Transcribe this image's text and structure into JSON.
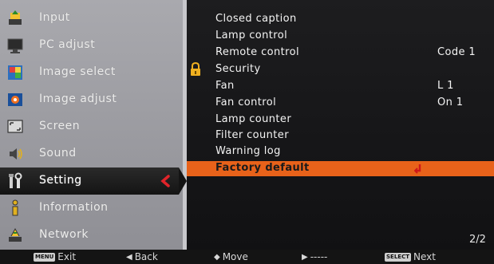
{
  "left_menu": {
    "items": [
      {
        "label": "Input",
        "icon": "input-icon"
      },
      {
        "label": "PC adjust",
        "icon": "monitor-icon"
      },
      {
        "label": "Image select",
        "icon": "image-select-icon"
      },
      {
        "label": "Image adjust",
        "icon": "image-adjust-icon"
      },
      {
        "label": "Screen",
        "icon": "screen-icon"
      },
      {
        "label": "Sound",
        "icon": "speaker-icon"
      },
      {
        "label": "Setting",
        "icon": "setting-icon",
        "active": true
      },
      {
        "label": "Information",
        "icon": "information-icon"
      },
      {
        "label": "Network",
        "icon": "network-icon"
      }
    ]
  },
  "settings_list": {
    "rows": [
      {
        "label": "Closed caption",
        "value": ""
      },
      {
        "label": "Lamp control",
        "value": ""
      },
      {
        "label": "Remote control",
        "value": "Code 1"
      },
      {
        "label": "Security",
        "value": "",
        "icon": "lock-icon"
      },
      {
        "label": "Fan",
        "value": "L 1"
      },
      {
        "label": "Fan control",
        "value": "On 1"
      },
      {
        "label": "Lamp counter",
        "value": ""
      },
      {
        "label": "Filter counter",
        "value": ""
      },
      {
        "label": "Warning log",
        "value": ""
      },
      {
        "label": "Factory default",
        "value": "",
        "selected": true,
        "icon": "enter-icon"
      }
    ],
    "page": "2/2"
  },
  "bottom_bar": {
    "menu_key": "MENU",
    "exit": "Exit",
    "back": "Back",
    "move": "Move",
    "next_dashes": "-----",
    "select_key": "SELECT",
    "next": "Next"
  },
  "colors": {
    "highlight": "#e8621a",
    "active_arrow": "#e0242a",
    "left_panel": "#9c9ca1",
    "right_panel": "#151517"
  }
}
